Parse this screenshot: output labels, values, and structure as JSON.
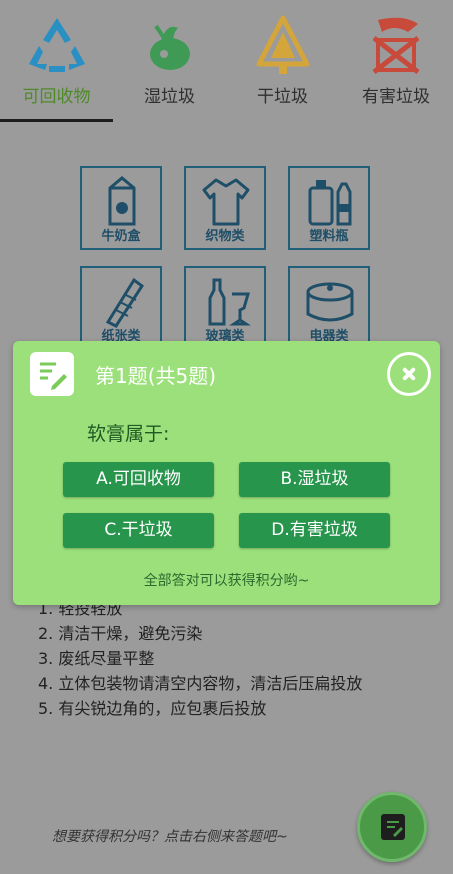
{
  "tabs": [
    {
      "label": "可回收物",
      "icon": "recycle-icon",
      "active": true
    },
    {
      "label": "湿垃圾",
      "icon": "wet-waste-icon",
      "active": false
    },
    {
      "label": "干垃圾",
      "icon": "dry-waste-icon",
      "active": false
    },
    {
      "label": "有害垃圾",
      "icon": "hazardous-icon",
      "active": false
    }
  ],
  "grid": [
    {
      "label": "牛奶盒",
      "icon": "milk-carton-icon"
    },
    {
      "label": "织物类",
      "icon": "clothing-icon"
    },
    {
      "label": "塑料瓶",
      "icon": "plastic-bottle-icon"
    },
    {
      "label": "纸张类",
      "icon": "paper-icon"
    },
    {
      "label": "玻璃类",
      "icon": "glass-icon"
    },
    {
      "label": "电器类",
      "icon": "appliance-icon"
    }
  ],
  "rules": [
    "1. 轻投轻放",
    "2. 清洁干燥，避免污染",
    "3. 废纸尽量平整",
    "4. 立体包装物请清空内容物，清洁后压扁投放",
    "5. 有尖锐边角的，应包裹后投放"
  ],
  "hint": "想要获得积分吗？点击右侧来答题吧~",
  "dialog": {
    "title": "第1题(共5题)",
    "question": "软膏属于:",
    "options": [
      "A.可回收物",
      "B.湿垃圾",
      "C.干垃圾",
      "D.有害垃圾"
    ],
    "footer": "全部答对可以获得积分哟~"
  },
  "colors": {
    "accent": "#9be07a",
    "button": "#27954b",
    "recycle": "#2a8fc2",
    "wet": "#3f9a55",
    "dry": "#d4a53a",
    "hazard": "#c84a3a"
  }
}
